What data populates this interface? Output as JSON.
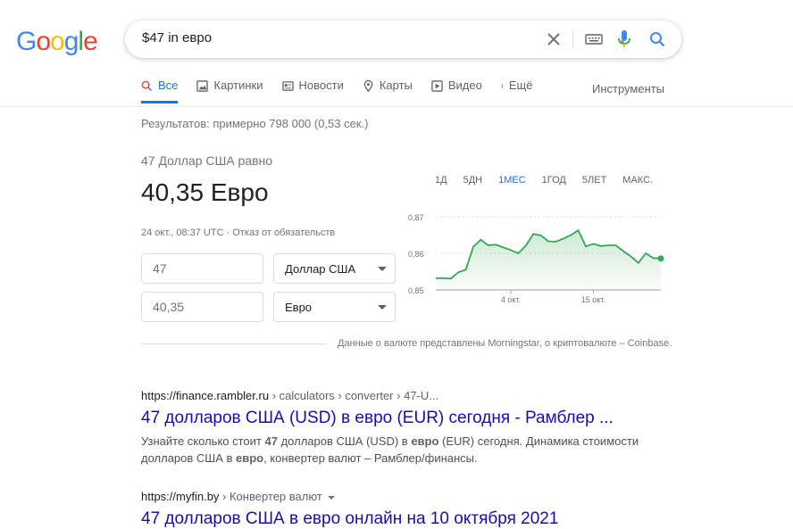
{
  "logo": {
    "letters": [
      "G",
      "o",
      "o",
      "g",
      "l",
      "e"
    ],
    "colors": [
      "#4285F4",
      "#EA4335",
      "#FBBC05",
      "#4285F4",
      "#34A853",
      "#EA4335"
    ]
  },
  "search": {
    "query": "$47 in евро"
  },
  "icons": {
    "clear": "close-icon",
    "keyboard": "keyboard-icon",
    "mic": "microphone-icon",
    "search": "search-icon"
  },
  "tabs": [
    {
      "label": "Все",
      "icon": "search-icon",
      "active": true
    },
    {
      "label": "Картинки",
      "icon": "image-icon"
    },
    {
      "label": "Новости",
      "icon": "news-icon"
    },
    {
      "label": "Карты",
      "icon": "map-pin-icon"
    },
    {
      "label": "Видео",
      "icon": "video-icon"
    },
    {
      "label": "Ещё",
      "icon": "more-vert-icon"
    }
  ],
  "tools_label": "Инструменты",
  "result_stats": "Результатов: примерно 798 000 (0,53 сек.)",
  "converter": {
    "subtitle": "47 Доллар США равно",
    "result": "40,35 Евро",
    "date": "24 окт., 08:37 UTC",
    "separator": " · ",
    "disclaimer": "Отказ от обязательств",
    "amount_from": "47",
    "amount_to": "40,35",
    "currency_from": "Доллар США",
    "currency_to": "Евро"
  },
  "range_tabs": [
    "1Д",
    "5ДН",
    "1МЕС",
    "1ГОД",
    "5ЛЕТ",
    "МАКС."
  ],
  "range_active": "1МЕС",
  "chart_data": {
    "type": "area",
    "ylim": [
      0.85,
      0.87
    ],
    "yticks": [
      "0,87",
      "0,86",
      "0,85"
    ],
    "xticks": [
      "4 окт.",
      "15 окт."
    ],
    "color": "#34A853",
    "values": [
      0.8532,
      0.8532,
      0.8531,
      0.8548,
      0.8555,
      0.8618,
      0.8637,
      0.8622,
      0.8624,
      0.8616,
      0.8609,
      0.86,
      0.8621,
      0.8653,
      0.8649,
      0.8633,
      0.8632,
      0.864,
      0.865,
      0.8663,
      0.8619,
      0.8626,
      0.862,
      0.8622,
      0.8622,
      0.8606,
      0.8592,
      0.8574,
      0.86,
      0.8587,
      0.8586
    ]
  },
  "attribution": "Данные о валюте представлены Morningstar, о криптовалюте – Coinbase.",
  "results": [
    {
      "domain": "https://finance.rambler.ru",
      "crumbs": " › calculators › converter › 47-U...",
      "title": "47 долларов США (USD) в евро (EUR) сегодня - Рамблер ...",
      "snippet_parts": [
        "Узнайте сколько стоит ",
        "47",
        " долларов США (USD) в ",
        "евро",
        " (EUR) сегодня. Динамика стоимости долларов США в ",
        "евро",
        ", конвертер валют – Рамблер/финансы."
      ]
    },
    {
      "domain": "https://myfin.by",
      "crumbs": " › Конвертер валют",
      "title": "47 долларов США в евро онлайн на 10 октября 2021"
    }
  ]
}
